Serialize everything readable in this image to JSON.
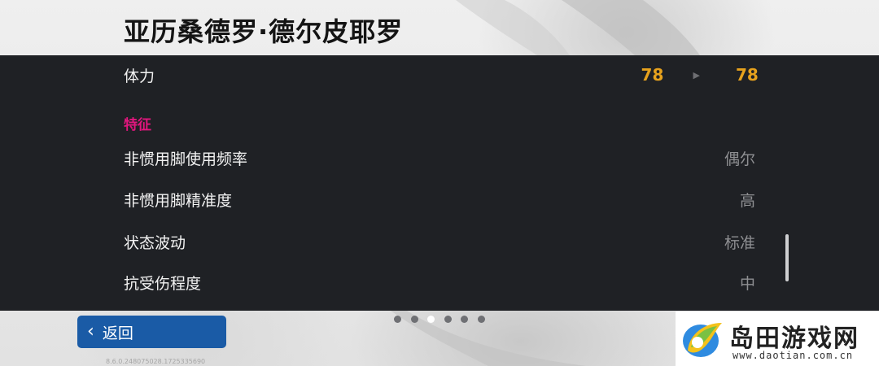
{
  "header": {
    "player_name": "亚历桑德罗·德尔皮耶罗"
  },
  "stats": {
    "stamina": {
      "label": "体力",
      "old_value": "78",
      "new_value": "78"
    }
  },
  "traits": {
    "section_title": "特征",
    "items": [
      {
        "label": "非惯用脚使用频率",
        "value": "偶尔"
      },
      {
        "label": "非惯用脚精准度",
        "value": "高"
      },
      {
        "label": "状态波动",
        "value": "标准"
      },
      {
        "label": "抗受伤程度",
        "value": "中"
      }
    ]
  },
  "footer": {
    "back_label": "返回",
    "version": "8.6.0.248075028.1725335690",
    "page_count": 6,
    "active_page": 3
  },
  "watermark": {
    "brand": "岛田游戏网",
    "url": "www.daotian.com.cn"
  },
  "colors": {
    "panel_bg": "#1f2125",
    "accent_value": "#e7a21d",
    "section_title": "#e2167e",
    "back_button": "#1a5ba6"
  },
  "icons": {
    "arrow": "play-triangle-icon",
    "back": "chevron-left-icon"
  }
}
